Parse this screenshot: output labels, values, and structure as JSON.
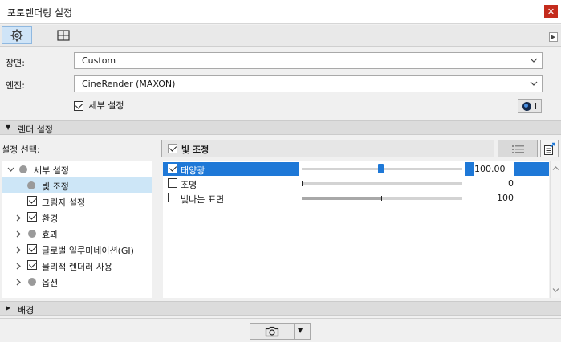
{
  "window": {
    "title": "포토렌더링 설정",
    "close_label": "✕"
  },
  "toolbar": {
    "tabs": [
      {
        "icon": "gear-icon"
      },
      {
        "icon": "view-icon"
      }
    ],
    "expand_arrow": "▶"
  },
  "scene": {
    "label": "장면:",
    "value": "Custom"
  },
  "engine": {
    "label": "엔진:",
    "value": "CineRender (MAXON)"
  },
  "detail_settings": {
    "label": "세부 설정",
    "checked": true,
    "info_label": "i"
  },
  "render_section": {
    "label": "렌더 설정",
    "arrow": "▼"
  },
  "settings_select": {
    "label": "설정 선택:"
  },
  "tree": {
    "items": [
      {
        "label": "세부 설정",
        "expander": "✓",
        "indicator": "dot"
      },
      {
        "label": "빛 조정",
        "indicator": "dot",
        "selected": true
      },
      {
        "label": "그림자 설정",
        "indicator": "checkbox",
        "checked": true
      },
      {
        "label": "환경",
        "expander": "›",
        "indicator": "checkbox",
        "checked": true
      },
      {
        "label": "효과",
        "expander": "›",
        "indicator": "dot"
      },
      {
        "label": "글로벌 일루미네이션(GI)",
        "expander": "›",
        "indicator": "checkbox",
        "checked": true
      },
      {
        "label": "물리적 렌더러 사용",
        "expander": "›",
        "indicator": "checkbox",
        "checked": true
      },
      {
        "label": "옵션",
        "expander": "›",
        "indicator": "dot"
      }
    ]
  },
  "panel": {
    "title": "빛 조정",
    "title_checked": true
  },
  "params": [
    {
      "label": "태양광",
      "checked": true,
      "value": "100.00",
      "slider": 0.5,
      "selected": true
    },
    {
      "label": "조명",
      "checked": false,
      "value": "0",
      "slider": 0.0
    },
    {
      "label": "빛나는 표면",
      "checked": false,
      "value": "100",
      "slider": 0.5
    }
  ],
  "background_section": {
    "label": "배경",
    "arrow": "▶"
  },
  "bottom": {
    "dropdown_arrow": "▼"
  },
  "colors": {
    "accent": "#1e78d7",
    "selected_row": "#cde6f7",
    "close": "#c42b1c"
  }
}
